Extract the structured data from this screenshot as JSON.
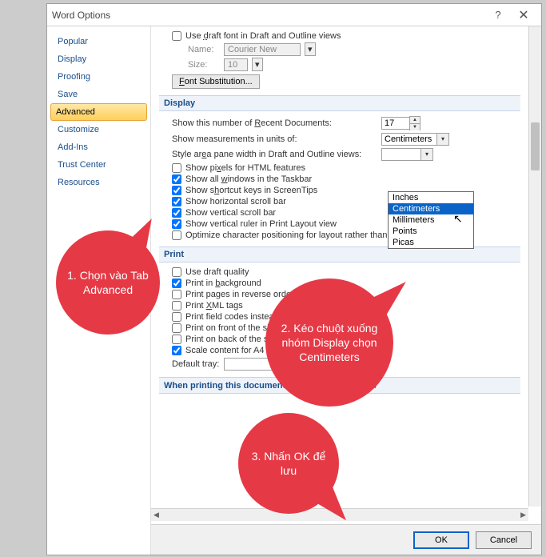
{
  "window": {
    "title": "Word Options"
  },
  "sidebar": {
    "items": [
      {
        "label": "Popular"
      },
      {
        "label": "Display"
      },
      {
        "label": "Proofing"
      },
      {
        "label": "Save"
      },
      {
        "label": "Advanced"
      },
      {
        "label": "Customize"
      },
      {
        "label": "Add-Ins"
      },
      {
        "label": "Trust Center"
      },
      {
        "label": "Resources"
      }
    ]
  },
  "top": {
    "draft_font": "Use draft font in Draft and Outline views",
    "name_label": "Name:",
    "name_value": "Courier New",
    "size_label": "Size:",
    "size_value": "10",
    "font_sub_btn": "Font Substitution..."
  },
  "display_section": {
    "header": "Display",
    "recent_label": "Show this number of Recent Documents:",
    "recent_value": "17",
    "units_label": "Show measurements in units of:",
    "units_value": "Centimeters",
    "style_pane_label": "Style area pane width in Draft and Outline views:",
    "chk_pixels": "Show pixels for HTML features",
    "chk_windows": "Show all windows in the Taskbar",
    "chk_shortcut": "Show shortcut keys in ScreenTips",
    "chk_hscroll": "Show horizontal scroll bar",
    "chk_vscroll": "Show vertical scroll bar",
    "chk_vruler": "Show vertical ruler in Print Layout view",
    "chk_optimize": "Optimize character positioning for layout rather than readability"
  },
  "units_dropdown": {
    "options": [
      "Inches",
      "Centimeters",
      "Millimeters",
      "Points",
      "Picas"
    ]
  },
  "print_section": {
    "chk_draft": "Use draft quality",
    "chk_background": "Print in background",
    "chk_reverse": "Print pages in reverse order",
    "chk_xml": "Print XML tags",
    "chk_field": "Print field codes instead of their values",
    "chk_front": "Print on front of the sheet for duplex printing",
    "chk_back": "Print on back of the sheet for duplex printing",
    "chk_scale": "Scale content for A4 or 8.5 x 11\" paper sizes",
    "default_tray": "Default tray:"
  },
  "when_section": {
    "header": "When printing this document:"
  },
  "footer": {
    "ok": "OK",
    "cancel": "Cancel"
  },
  "callouts": {
    "c1": "1. Chọn vào Tab Advanced",
    "c2": "2. Kéo chuột xuống nhóm Display chọn Centimeters",
    "c3": "3. Nhấn OK để lưu"
  }
}
